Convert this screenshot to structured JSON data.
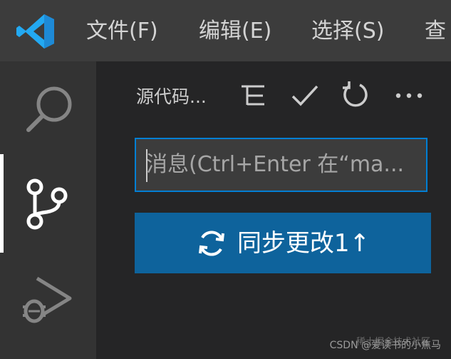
{
  "colors": {
    "titlebar_bg": "#3c3c3c",
    "activitybar_bg": "#333333",
    "sidebar_bg": "#252526",
    "accent_blue": "#0e639c",
    "input_focus_border": "#007fd4",
    "logo_blue": "#23a9f2"
  },
  "titlebar": {
    "logo": "vscode-logo-icon",
    "menu": [
      {
        "label": "文件(F)"
      },
      {
        "label": "编辑(E)"
      },
      {
        "label": "选择(S)"
      },
      {
        "label": "查"
      }
    ]
  },
  "activitybar": {
    "items": [
      {
        "icon": "search-icon",
        "active": false
      },
      {
        "icon": "source-control-icon",
        "active": true
      },
      {
        "icon": "run-debug-icon",
        "active": false
      }
    ]
  },
  "scm": {
    "title": "源代码...",
    "actions": [
      {
        "icon": "view-as-tree-icon"
      },
      {
        "icon": "commit-check-icon"
      },
      {
        "icon": "refresh-icon"
      },
      {
        "icon": "more-actions-icon"
      }
    ],
    "message_input": {
      "placeholder": "消息(Ctrl+Enter 在“ma...",
      "value": ""
    },
    "sync_button": {
      "icon": "sync-icon",
      "label": "同步更改1↑"
    }
  },
  "watermark": {
    "text": "CSDN @爱读书的小焦马",
    "faint_text": "稀土掘金技术社区"
  }
}
